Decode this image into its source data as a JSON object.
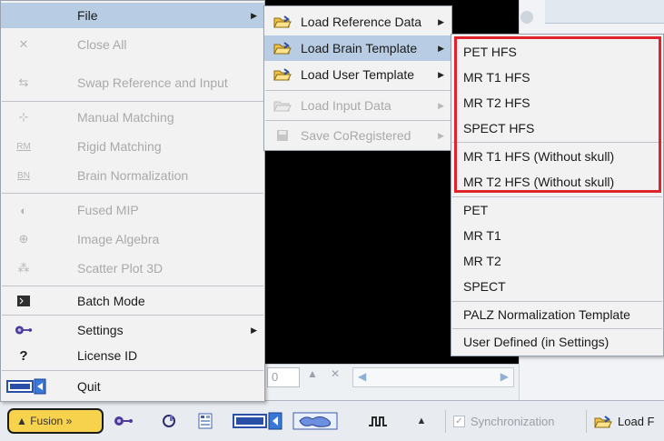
{
  "app": {
    "spin_value": "0",
    "fusion_button_label": "▲ Fusion »",
    "synchronization_label": "Synchronization",
    "load_button_label": "Load F"
  },
  "main_menu": {
    "items": [
      {
        "label": "File",
        "enabled": true,
        "highlighted": true,
        "has_submenu": true,
        "icon": "folder-icon"
      },
      {
        "label": "Close All",
        "enabled": false,
        "icon": "close-all-icon"
      },
      {
        "label": "Swap Reference and Input",
        "enabled": false,
        "icon": "swap-icon"
      },
      {
        "label": "Manual Matching",
        "enabled": false,
        "icon": "manual-matching-icon"
      },
      {
        "label": "Rigid Matching",
        "enabled": false,
        "icon": "rigid-matching-icon"
      },
      {
        "label": "Brain Normalization",
        "enabled": false,
        "icon": "brain-normalization-icon"
      },
      {
        "label": "Fused MIP",
        "enabled": false,
        "icon": "fused-mip-icon"
      },
      {
        "label": "Image Algebra",
        "enabled": false,
        "icon": "image-algebra-icon"
      },
      {
        "label": "Scatter Plot 3D",
        "enabled": false,
        "icon": "scatter-plot-icon"
      },
      {
        "label": "Batch Mode",
        "enabled": true,
        "icon": "batch-mode-icon"
      },
      {
        "label": "Settings",
        "enabled": true,
        "has_submenu": true,
        "icon": "settings-icon"
      },
      {
        "label": "License ID",
        "enabled": true,
        "icon": "question-icon"
      },
      {
        "label": "Quit",
        "enabled": true,
        "icon": "exit-icon"
      }
    ]
  },
  "file_submenu": {
    "items": [
      {
        "label": "Load Reference Data",
        "enabled": true,
        "has_submenu": true,
        "icon": "open-folder-icon"
      },
      {
        "label": "Load Brain Template",
        "enabled": true,
        "highlighted": true,
        "has_submenu": true,
        "icon": "open-folder-icon"
      },
      {
        "label": "Load User Template",
        "enabled": true,
        "has_submenu": true,
        "icon": "open-folder-icon"
      },
      {
        "label": "Load Input Data",
        "enabled": false,
        "has_submenu": true,
        "icon": "open-folder-icon"
      },
      {
        "label": "Save CoRegistered",
        "enabled": false,
        "has_submenu": true,
        "icon": "save-icon"
      }
    ]
  },
  "template_submenu": {
    "items": [
      {
        "label": "PET HFS"
      },
      {
        "label": "MR T1 HFS"
      },
      {
        "label": "MR T2 HFS"
      },
      {
        "label": "SPECT HFS"
      },
      {
        "label": "MR T1 HFS (Without skull)"
      },
      {
        "label": "MR T2 HFS (Without skull)"
      },
      {
        "label": "PET"
      },
      {
        "label": "MR T1"
      },
      {
        "label": "MR T2"
      },
      {
        "label": "SPECT"
      },
      {
        "label": "PALZ Normalization Template"
      },
      {
        "label": "User Defined (in Settings)"
      }
    ]
  },
  "colors": {
    "highlight": "#b8cde4",
    "menu_background": "#f2f2f2",
    "disabled_text": "#a9a9a9",
    "annotation_box": "#e0242c",
    "fusion_button": "#f7d24d"
  }
}
